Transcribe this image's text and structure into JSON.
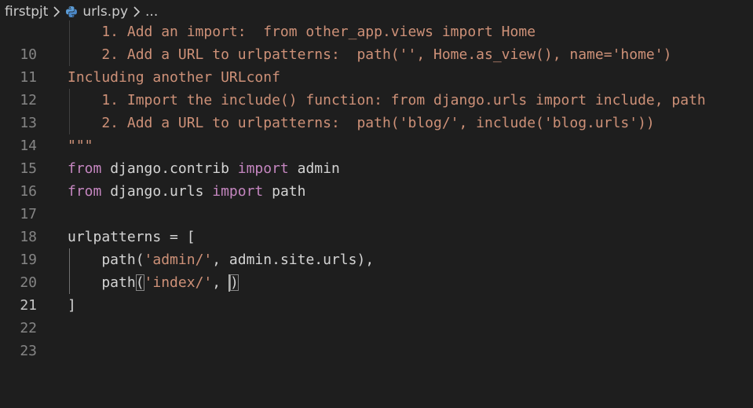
{
  "breadcrumb": {
    "folder": "firstpjt",
    "file": "urls.py",
    "more": "..."
  },
  "editor": {
    "current_line": 21,
    "lines": [
      {
        "num": "10",
        "text": "    1. Add an import:  from other_app.views import Home"
      },
      {
        "num": "11",
        "text": "    2. Add a URL to urlpatterns:  path('', Home.as_view(), name='home')"
      },
      {
        "num": "12",
        "text": "Including another URLconf"
      },
      {
        "num": "13",
        "text": "    1. Import the include() function: from django.urls import include, path"
      },
      {
        "num": "14",
        "text": "    2. Add a URL to urlpatterns:  path('blog/', include('blog.urls'))"
      },
      {
        "num": "15",
        "text": "\"\"\""
      },
      {
        "num": "16",
        "kw1": "from",
        "mid": " django.contrib ",
        "kw2": "import",
        "end": " admin"
      },
      {
        "num": "17",
        "kw1": "from",
        "mid": " django.urls ",
        "kw2": "import",
        "end": " path"
      },
      {
        "num": "18",
        "text": ""
      },
      {
        "num": "19",
        "text": "urlpatterns = ["
      },
      {
        "num": "20",
        "pre": "    path(",
        "str": "'admin/'",
        "post": ", admin.site.urls),"
      },
      {
        "num": "21",
        "pre": "    path",
        "open": "(",
        "str": "'index/'",
        "post": ", ",
        "close": ")"
      },
      {
        "num": "22",
        "text": "]"
      },
      {
        "num": "23",
        "text": ""
      }
    ]
  },
  "colors": {
    "background": "#1e1e1e",
    "docstring": "#ce9178",
    "keyword": "#c586c0",
    "default_text": "#d4d4d4",
    "line_number": "#858585"
  },
  "icons": {
    "file_icon": "python-icon",
    "separator_icon": "chevron-right-icon"
  }
}
